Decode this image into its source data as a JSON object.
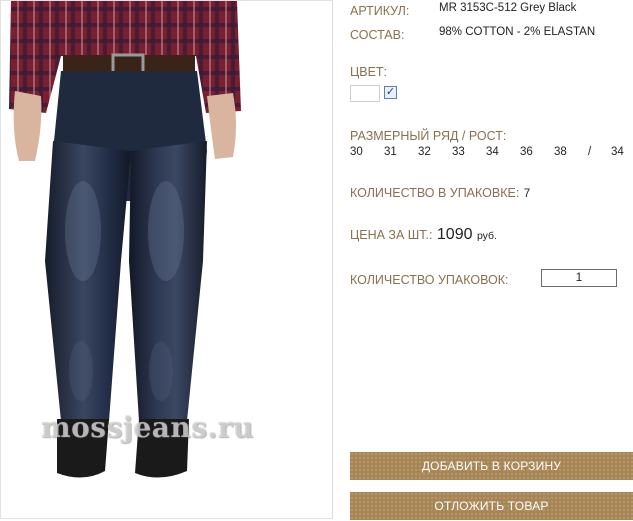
{
  "product": {
    "image_alt": "jeans-photo",
    "watermark": "mossjeans.ru",
    "article_label": "АРТИКУЛ:",
    "article_value": "MR 3153C-512 Grey Black",
    "composition_label": "СОСТАВ:",
    "composition_value": "98% COTTON - 2% ELASTAN",
    "color_label": "ЦВЕТ:",
    "color_checked": true,
    "size_label": "РАЗМЕРНЫЙ РЯД / РОСТ:",
    "sizes": [
      "30",
      "31",
      "32",
      "33",
      "34",
      "36",
      "38",
      "/",
      "34"
    ],
    "pack_qty_label": "КОЛИЧЕСТВО В УПАКОВКЕ:",
    "pack_qty_value": "7",
    "price_label": "ЦЕНА ЗА ШТ.:",
    "price_value": "1090",
    "price_currency": "руб.",
    "packs_label": "КОЛИЧЕСТВО УПАКОВОК:",
    "packs_value": "1"
  },
  "buttons": {
    "add_to_cart": "ДОБАВИТЬ В КОРЗИНУ",
    "defer": "ОТЛОЖИТЬ ТОВАР"
  },
  "colors": {
    "label": "#8b6f4e",
    "button": "#a78554"
  }
}
